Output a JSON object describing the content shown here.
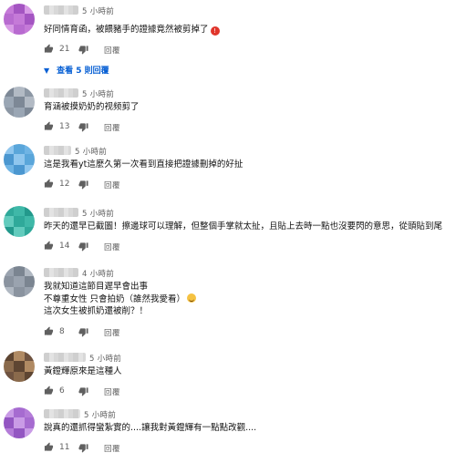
{
  "comments": [
    {
      "time": "5 小時前",
      "lines": [
        "好同情育函，被餵豬手的證據竟然被剪掉了"
      ],
      "emoji": "red-exclaim",
      "likes": "21",
      "reply_label": "回覆",
      "view_replies": "查看 5 則回覆",
      "avatar_colors": [
        "#c57ad8",
        "#a455c2",
        "#d89be6",
        "#b86bd0"
      ]
    },
    {
      "time": "5 小時前",
      "lines": [
        "育涵被摸奶奶的视频剪了"
      ],
      "likes": "13",
      "reply_label": "回覆",
      "avatar_colors": [
        "#9aa6b4",
        "#7d8896",
        "#b2bac4",
        "#8c97a4"
      ]
    },
    {
      "time": "5 小時前",
      "lines": [
        "這是我看yt這麼久第一次看到直接把證據刪掉的好扯"
      ],
      "likes": "12",
      "reply_label": "回覆",
      "avatar_colors": [
        "#6fb4e4",
        "#4b97d0",
        "#8fc6ee",
        "#5aa6da"
      ]
    },
    {
      "time": "5 小時前",
      "lines": [
        "昨天的還早已截圖！擦邊球可以理解，但整個手掌就太扯，且貼上去時一點也沒要閃的意思，從頭貼到尾"
      ],
      "likes": "14",
      "reply_label": "回覆",
      "avatar_colors": [
        "#3fb8a8",
        "#23998c",
        "#62cbbd",
        "#2fa99a"
      ]
    },
    {
      "time": "4 小時前",
      "lines": [
        "我就知道這節目遲早會出事",
        "不尊重女性 只會拍奶（誰然我愛看）",
        "這次女生被抓奶還被削？！"
      ],
      "emoji_line": 1,
      "likes": "8",
      "reply_label": "回覆",
      "avatar_colors": [
        "#9aa3af",
        "#7b8591",
        "#b0b8c2",
        "#8a939f"
      ]
    },
    {
      "time": "5 小時前",
      "lines": [
        "黃鐙輝原來是這種人"
      ],
      "likes": "6",
      "reply_label": "回覆",
      "avatar_colors": [
        "#8a6a4c",
        "#5e4532",
        "#b08a63",
        "#6f5340"
      ]
    },
    {
      "time": "5 小時前",
      "lines": [
        "說真的還抓得蠻紮實的....讓我對黃鐙輝有一點點改觀...."
      ],
      "likes": "11",
      "reply_label": "回覆",
      "avatar_colors": [
        "#b47cd8",
        "#9356c2",
        "#c99be6",
        "#a66bd0"
      ]
    }
  ],
  "colors": {
    "text": "#111111",
    "meta": "#606060",
    "link": "#065fd4"
  }
}
